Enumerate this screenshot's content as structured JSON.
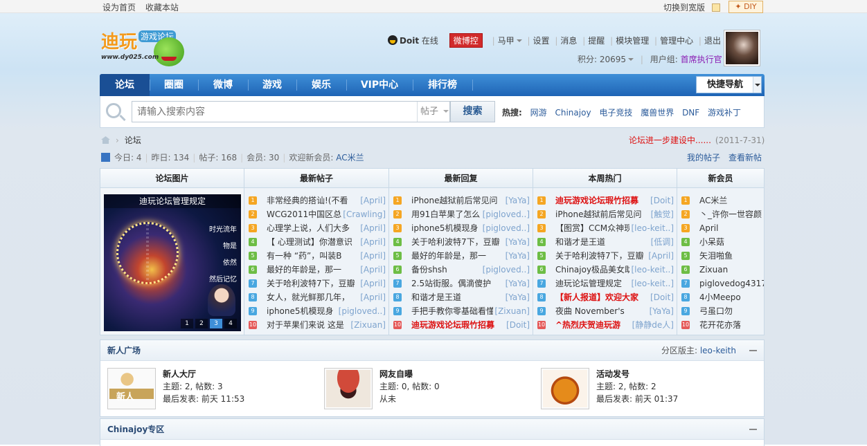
{
  "topbar": {
    "set_home": "设为首页",
    "bookmark": "收藏本站",
    "switch_width": "切换到宽版",
    "diy": "✦ DIY"
  },
  "logo": {
    "main": "迪玩",
    "sub": "游戏论坛",
    "url": "www.dy025.com"
  },
  "user": {
    "name": "Doit",
    "status": "在线",
    "weibo": "微博控",
    "majia": "马甲",
    "menu": [
      "设置",
      "消息",
      "提醒",
      "模块管理",
      "管理中心",
      "退出"
    ],
    "points_label": "积分: 20695",
    "group_label": "用户组:",
    "group": "首席执行官"
  },
  "nav": {
    "items": [
      "论坛",
      "圈圈",
      "微博",
      "游戏",
      "娱乐",
      "VIP中心",
      "排行榜"
    ],
    "quick": "快捷导航"
  },
  "search": {
    "placeholder": "请输入搜索内容",
    "scope": "帖子",
    "button": "搜索",
    "hot_label": "热搜:",
    "hot": [
      "网游",
      "Chinajoy",
      "电子竞技",
      "魔兽世界",
      "DNF",
      "游戏补丁"
    ]
  },
  "breadcrumb": {
    "current": "论坛"
  },
  "notice": {
    "text": "论坛进一步建设中......",
    "date": "(2011-7-31)"
  },
  "stats": {
    "today": "今日: 4",
    "yesterday": "昨日: 134",
    "posts": "帖子: 168",
    "members": "会员: 30",
    "welcome": "欢迎新会员:",
    "newest": "AC米兰"
  },
  "links": {
    "my_posts": "我的帖子",
    "new_posts": "查看新帖"
  },
  "grid": {
    "headers": [
      "论坛图片",
      "最新帖子",
      "最新回复",
      "本周热门",
      "新会员"
    ],
    "slide": {
      "caption": "迪玩论坛管理规定",
      "overlay": [
        "时光流年",
        "物是",
        "依然",
        "然后记忆"
      ],
      "pages": [
        "1",
        "2",
        "3",
        "4"
      ]
    },
    "latest_posts": [
      {
        "t": "非常经典的搭讪!(不看",
        "a": "[April]"
      },
      {
        "t": "WCG2011中国区总",
        "a": "[Crawling]"
      },
      {
        "t": "心理学上说，人们大多",
        "a": "[April]"
      },
      {
        "t": "【 心理测试】你潜意识",
        "a": "[April]"
      },
      {
        "t": "有一种 “药”，叫装B",
        "a": "[April]"
      },
      {
        "t": "最好的年龄是，那一",
        "a": "[April]"
      },
      {
        "t": "关于哈利波特7下，豆瓣",
        "a": "[April]"
      },
      {
        "t": "女人，就光鲜那几年，",
        "a": "[April]"
      },
      {
        "t": "iphone5机模现身",
        "a": "[pigloved..]"
      },
      {
        "t": "对于苹果们来说 这是",
        "a": "[Zixuan]"
      }
    ],
    "latest_replies": [
      {
        "t": "iPhone越狱前后常见问",
        "a": "[YaYa]"
      },
      {
        "t": "用91白苹果了怎么",
        "a": "[pigloved..]"
      },
      {
        "t": "iphone5机模现身",
        "a": "[pigloved..]"
      },
      {
        "t": "关于哈利波特7下，豆瓣",
        "a": "[YaYa]"
      },
      {
        "t": "最好的年龄是，那一",
        "a": "[YaYa]"
      },
      {
        "t": "备份shsh",
        "a": "[pigloved..]"
      },
      {
        "t": "2.5站街服。偶滴傻护",
        "a": "[YaYa]"
      },
      {
        "t": "和谐才是王道",
        "a": "[YaYa]"
      },
      {
        "t": "手把手教你零基础看懂",
        "a": "[Zixuan]"
      },
      {
        "t": "迪玩游戏论坛瑕竹招募",
        "a": "[Doit]",
        "red": true
      }
    ],
    "weekly_hot": [
      {
        "t": "迪玩游戏论坛瑕竹招募",
        "a": "[Doit]",
        "red": true
      },
      {
        "t": "iPhone越狱前后常见问",
        "a": "[触觉]"
      },
      {
        "t": "【图赏】CCM众神现",
        "a": "[leo-keit..]"
      },
      {
        "t": "和谐才是王道",
        "a": "[低调]"
      },
      {
        "t": "关于哈利波特7下，豆瓣",
        "a": "[April]"
      },
      {
        "t": "Chinajoy极品美女助",
        "a": "[leo-keit..]"
      },
      {
        "t": "迪玩论坛管理规定",
        "a": "[leo-keit..]"
      },
      {
        "t": "【新人报道】欢迎大家",
        "a": "[Doit]",
        "red": true
      },
      {
        "t": "夜曲 November's",
        "a": "[YaYa]"
      },
      {
        "t": "^热烈庆贺迪玩游",
        "a": "[静静de人]",
        "red": true
      }
    ],
    "new_members": [
      "AC米兰",
      "丶_许你一世容颜",
      "April",
      "小呆菇",
      "矢泪啪鱼",
      "Zixuan",
      "piglovedog4317",
      "4小Meepo",
      "弓虽口勿",
      "花开花亦落"
    ]
  },
  "sections": {
    "newbie": {
      "title": "新人广场",
      "moderator_label": "分区版主:",
      "moderator": "leo-keith",
      "forums": [
        {
          "name": "新人大厅",
          "stats": "主题: 2, 帖数: 3",
          "last": "最后发表: 前天 11:53",
          "img_text": "新人"
        },
        {
          "name": "网友自曝",
          "stats": "主题: 0, 帖数: 0",
          "last": "从未"
        },
        {
          "name": "活动发号",
          "stats": "主题: 2, 帖数: 2",
          "last": "最后发表: 前天 01:37"
        }
      ]
    },
    "chinajoy": {
      "title": "Chinajoy专区"
    }
  }
}
